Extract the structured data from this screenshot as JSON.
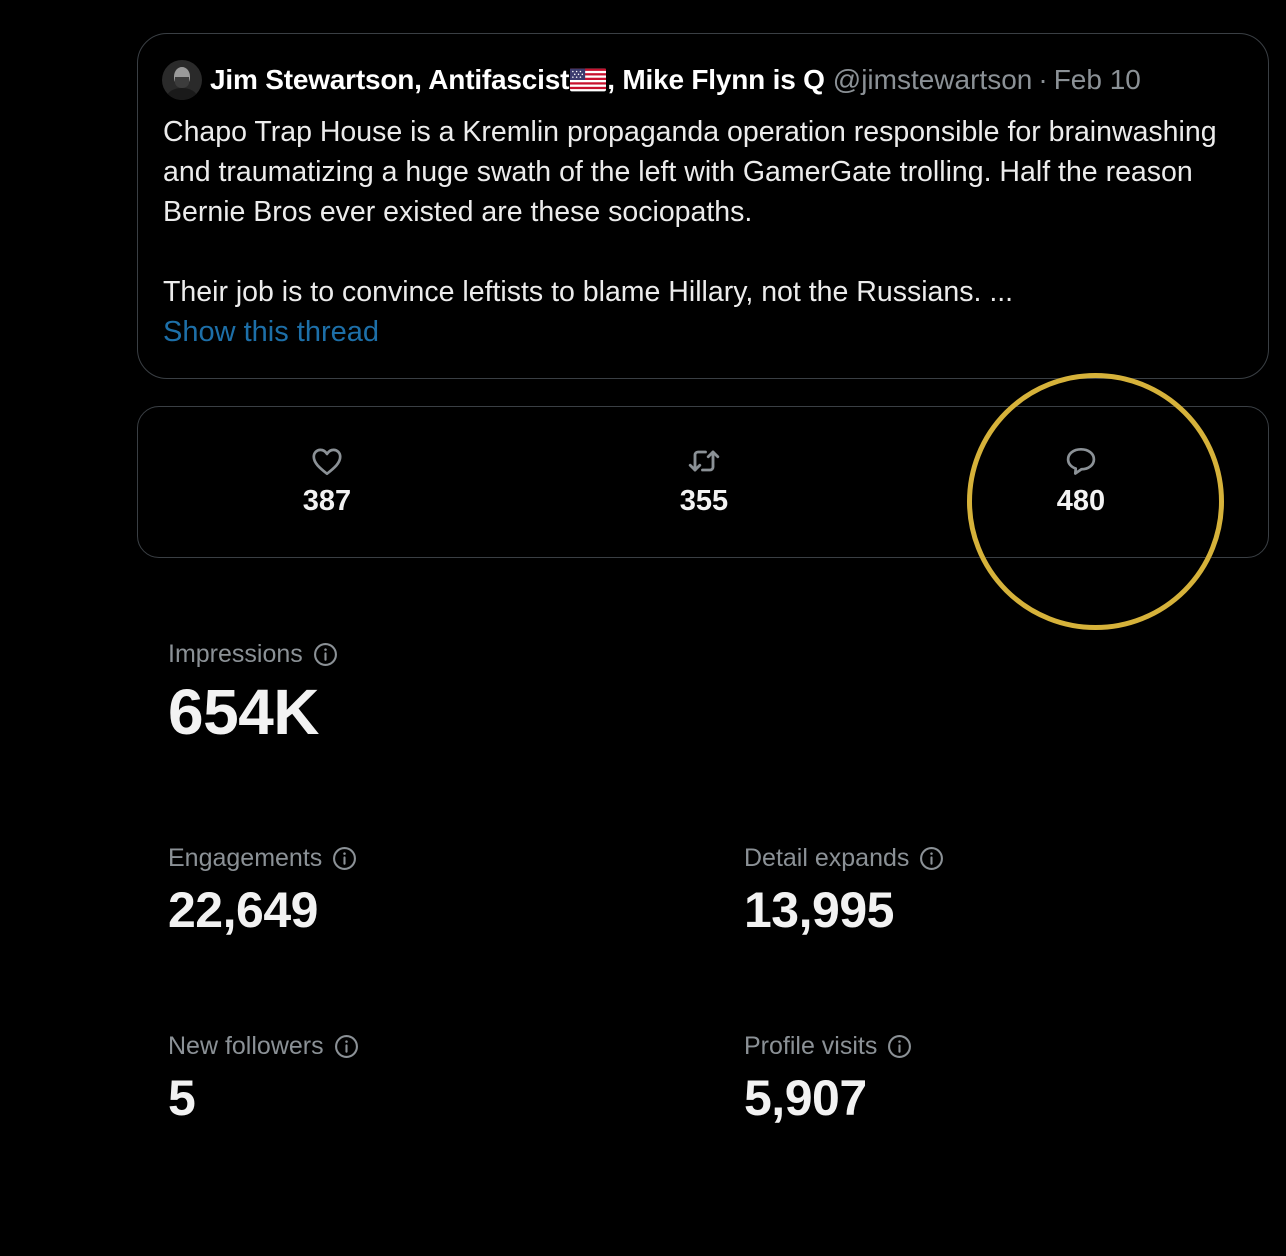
{
  "tweet": {
    "author_name_part1": "Jim Stewartson, Antifascist",
    "author_name_part2": ", Mike Flynn is Q",
    "handle": "@jimstewartson",
    "separator": "·",
    "date": "Feb 10",
    "text_paragraphs": [
      "Chapo Trap House is a Kremlin propaganda operation responsible for brainwashing and traumatizing a huge swath of the left with GamerGate trolling. Half the reason Bernie Bros ever existed are these sociopaths.",
      "Their job is to convince leftists to blame Hillary, not the Russians. ..."
    ],
    "show_thread_label": "Show this thread",
    "flag_icon": "us-flag-icon",
    "link_color": "#1d6fa8"
  },
  "actions": {
    "likes": {
      "icon": "heart-icon",
      "count": "387"
    },
    "retweets": {
      "icon": "retweet-icon",
      "count": "355"
    },
    "replies": {
      "icon": "reply-bubble-icon",
      "count": "480"
    }
  },
  "highlight": {
    "color": "#d6b23a",
    "target": "replies"
  },
  "metrics": {
    "impressions": {
      "label": "Impressions",
      "value": "654K"
    },
    "engagements": {
      "label": "Engagements",
      "value": "22,649"
    },
    "detail_expands": {
      "label": "Detail expands",
      "value": "13,995"
    },
    "new_followers": {
      "label": "New followers",
      "value": "5"
    },
    "profile_visits": {
      "label": "Profile visits",
      "value": "5,907"
    }
  }
}
